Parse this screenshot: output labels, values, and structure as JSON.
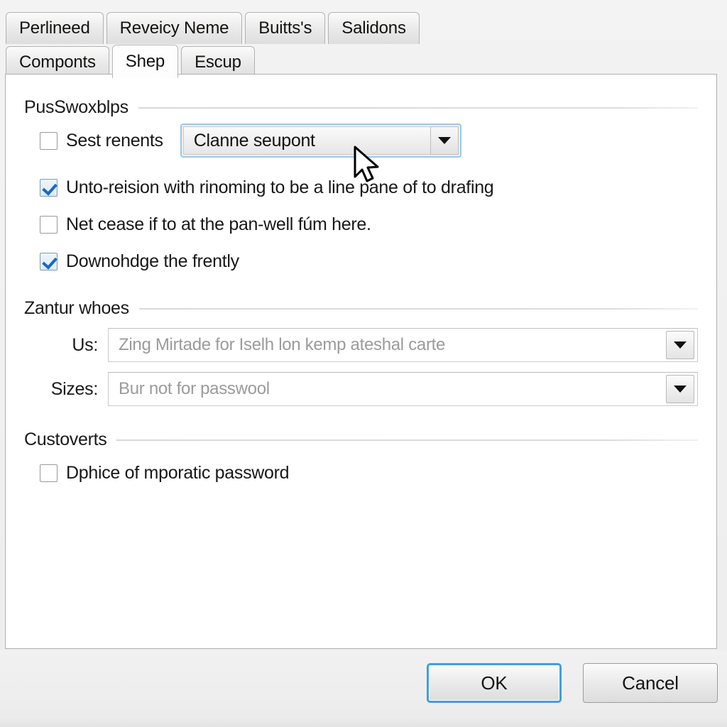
{
  "tabs": {
    "row1": [
      {
        "label": "Perlineed",
        "active": false
      },
      {
        "label": "Reveicy Neme",
        "active": false
      },
      {
        "label": "Buitts's",
        "active": false
      },
      {
        "label": "Salidons",
        "active": false
      }
    ],
    "row2": [
      {
        "label": "Componts",
        "active": false
      },
      {
        "label": "Shep",
        "active": true
      },
      {
        "label": "Escup",
        "active": false
      }
    ]
  },
  "groups": {
    "passwords": {
      "header": "PusSwoxblps",
      "checkbox_inline": {
        "label": "Sest renents",
        "checked": false
      },
      "combo_inline": {
        "value": "Clanne seupont",
        "arrow": "chevron-down-icon"
      },
      "checkboxes": [
        {
          "label": "Unto-reision with rinoming to be a line pane of to drafing",
          "checked": true
        },
        {
          "label": "Net cease if to at the pan-well fúm here.",
          "checked": false
        },
        {
          "label": "Downohdge the frently",
          "checked": true
        }
      ]
    },
    "zantur": {
      "header": "Zantur whoes",
      "fields": [
        {
          "label": "Us:",
          "value": "Zing Mirtade for Iselh lon kemp ateshal carte",
          "arrow": "chevron-down-icon"
        },
        {
          "label": "Sizes:",
          "value": "Bur not for passwool",
          "arrow": "chevron-down-icon"
        }
      ]
    },
    "custoverts": {
      "header": "Custoverts",
      "checkboxes": [
        {
          "label": "Dphice of mporatic password",
          "checked": false
        }
      ]
    }
  },
  "footer": {
    "ok_label": "OK",
    "cancel_label": "Cancel"
  },
  "cursor": {
    "icon": "mouse-pointer-icon"
  },
  "colors": {
    "accent_focus": "#3e9fe0",
    "check_blue": "#1768c4",
    "panel_bg": "#ffffff",
    "dialog_bg": "#efefef",
    "disabled_text": "#9b9b9b"
  }
}
